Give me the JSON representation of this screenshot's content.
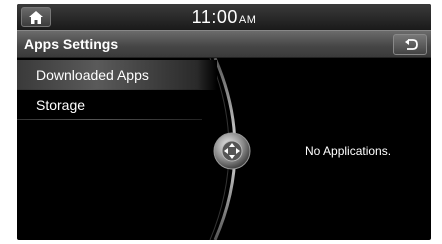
{
  "status_bar": {
    "time": "11:00",
    "ampm": "AM"
  },
  "header": {
    "title": "Apps Settings"
  },
  "menu": {
    "items": [
      {
        "label": "Downloaded Apps",
        "selected": true
      },
      {
        "label": "Storage",
        "selected": false
      }
    ]
  },
  "content": {
    "empty_message": "No Applications."
  },
  "icons": {
    "home": "home-icon",
    "back": "back-arrow-icon",
    "scroll": "joystick-scroll-icon"
  }
}
